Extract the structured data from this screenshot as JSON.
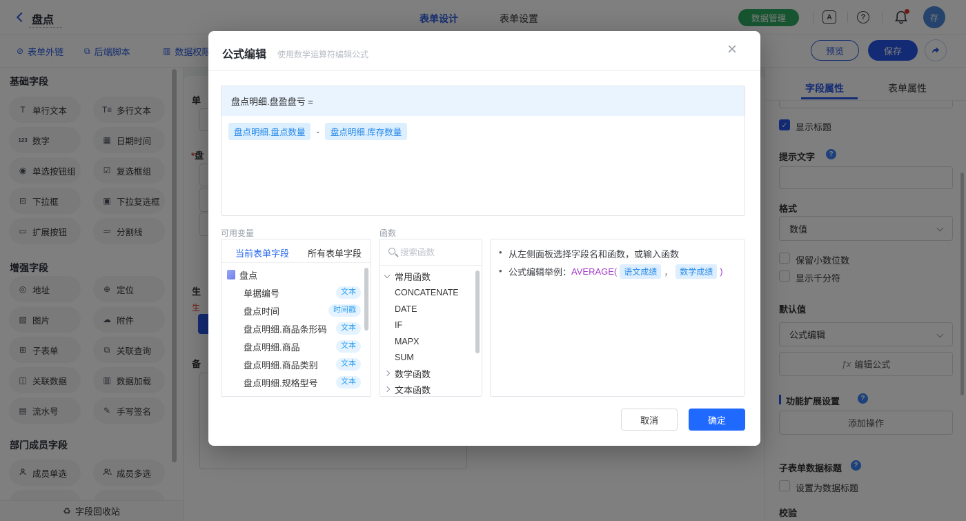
{
  "topbar": {
    "back_title": "盘点",
    "tab_design": "表单设计",
    "tab_settings": "表单设置",
    "data_manage": "数据管理",
    "avatar": "存",
    "book_glyph": "A",
    "help_glyph": "?"
  },
  "toolbar": {
    "links": [
      "表单外链",
      "后端脚本",
      "数据权限"
    ],
    "preview": "预览",
    "save": "保存"
  },
  "sidebar": {
    "sections": [
      {
        "title": "基础字段",
        "items": [
          "单行文本",
          "多行文本",
          "数字",
          "日期时间",
          "单选按钮组",
          "复选框组",
          "下拉框",
          "下拉复选框",
          "扩展按钮",
          "分割线"
        ]
      },
      {
        "title": "增强字段",
        "items": [
          "地址",
          "定位",
          "图片",
          "附件",
          "子表单",
          "关联查询",
          "关联数据",
          "数据加载",
          "流水号",
          "手写签名"
        ]
      },
      {
        "title": "部门成员字段",
        "items": [
          "成员单选",
          "成员多选"
        ]
      }
    ],
    "recycle": "字段回收站"
  },
  "canvas": {
    "label1": "单",
    "label2": "盘",
    "required_mark": "*",
    "label3": "生",
    "error_text": "生",
    "label4": "备"
  },
  "right_sidebar": {
    "tab_field": "字段属性",
    "tab_form": "表单属性",
    "show_title": "显示标题",
    "hint_label": "提示文字",
    "format_label": "格式",
    "format_value": "数值",
    "keep_decimal": "保留小数位数",
    "thousand_sep": "显示千分符",
    "default_label": "默认值",
    "default_value": "公式编辑",
    "fx": "ƒx",
    "edit_formula": "编辑公式",
    "ext_section": "功能扩展设置",
    "add_action": "添加操作",
    "subform_title": "子表单数据标题",
    "set_data_title": "设置为数据标题",
    "validation": "校验"
  },
  "modal": {
    "title": "公式编辑",
    "subtitle": "使用数学运算符编辑公式",
    "formula_target": "盘点明细.盘盈盘亏 =",
    "token1": "盘点明细.盘点数量",
    "operator": "-",
    "token2": "盘点明细.库存数量",
    "vars_label": "可用变量",
    "tab_current": "当前表单字段",
    "tab_all": "所有表单字段",
    "tree_root": "盘点",
    "fields": [
      {
        "name": "单据编号",
        "tag": "文本"
      },
      {
        "name": "盘点时间",
        "tag": "时间戳"
      },
      {
        "name": "盘点明细.商品条形码",
        "tag": "文本"
      },
      {
        "name": "盘点明细.商品",
        "tag": "文本"
      },
      {
        "name": "盘点明细.商品类别",
        "tag": "文本"
      },
      {
        "name": "盘点明细.规格型号",
        "tag": "文本"
      }
    ],
    "func_label": "函数",
    "search_placeholder": "搜索函数",
    "group1": "常用函数",
    "functions": [
      "CONCATENATE",
      "DATE",
      "IF",
      "MAPX",
      "SUM"
    ],
    "group2": "数学函数",
    "group3": "文本函数",
    "tip1": "从左侧面板选择字段名和函数，或输入函数",
    "tip2_prefix": "公式编辑举例：",
    "tip2_func": "AVERAGE(",
    "tip2_arg1": "语文成绩",
    "tip2_comma": "，",
    "tip2_arg2": "数学成绩",
    "tip2_close": ")",
    "cancel": "取消",
    "ok": "确定"
  },
  "colors": {
    "primary_blue": "#2656e8",
    "modal_blue": "#1f69ff",
    "green": "#2faa62",
    "chip_bg": "#dcefff",
    "chip_text": "#2486e8",
    "tag_bg": "#e4f3ff",
    "tag_text": "#2e9ff0",
    "function_purple": "#a43ac8",
    "error_red": "#e03b2a"
  }
}
